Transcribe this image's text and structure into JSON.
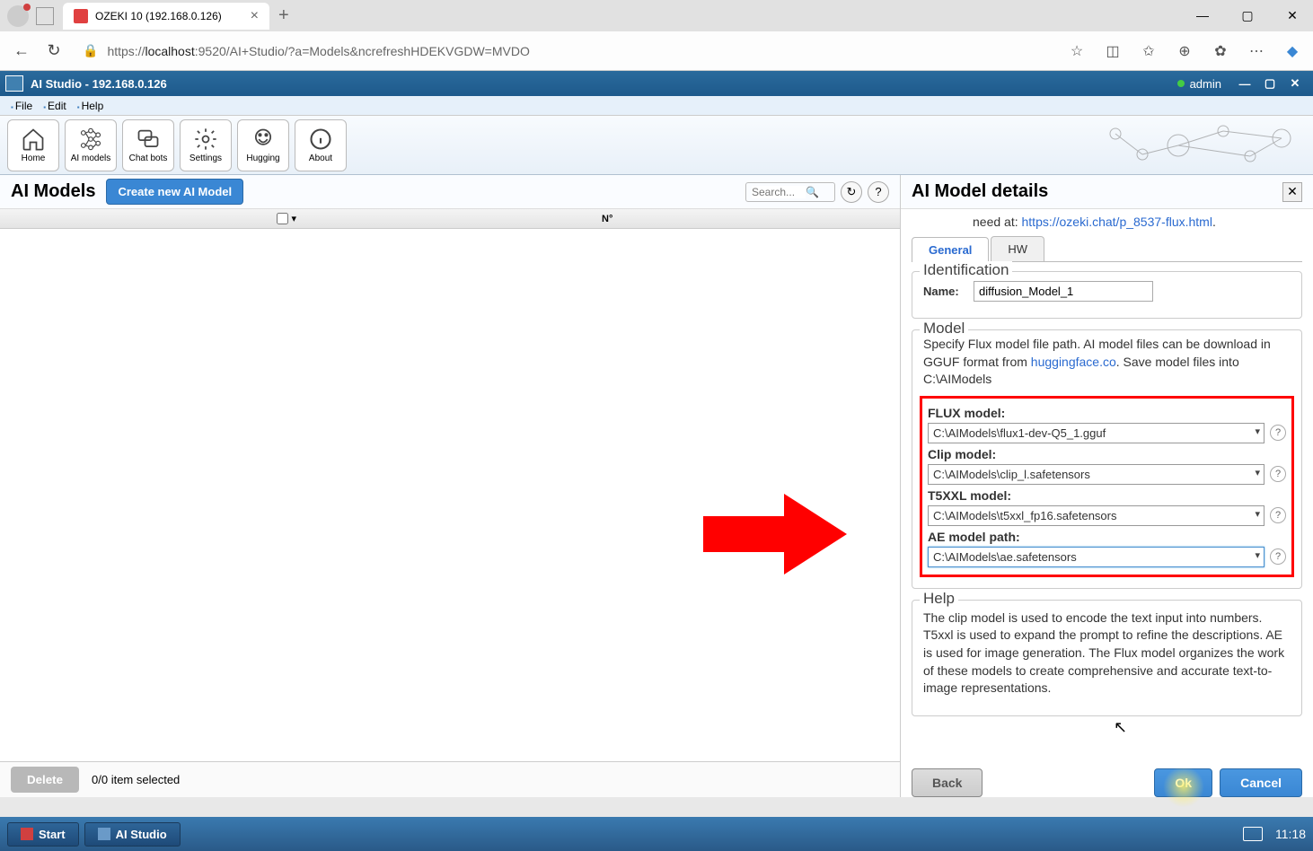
{
  "browser": {
    "tab_title": "OZEKI 10 (192.168.0.126)",
    "url_prefix": "https://",
    "url_host": "localhost",
    "url_rest": ":9520/AI+Studio/?a=Models&ncrefreshHDEKVGDW=MVDO"
  },
  "app": {
    "title": "AI Studio - 192.168.0.126",
    "user": "admin"
  },
  "menu": {
    "file": "File",
    "edit": "Edit",
    "help": "Help"
  },
  "toolbar": {
    "home": "Home",
    "models": "AI models",
    "chatbots": "Chat bots",
    "settings": "Settings",
    "hugging": "Hugging",
    "about": "About"
  },
  "left": {
    "title": "AI Models",
    "create_btn": "Create new AI Model",
    "search_placeholder": "Search...",
    "col_no": "N°",
    "delete": "Delete",
    "selection": "0/0 item selected"
  },
  "right": {
    "title": "AI Model details",
    "need_prefix": "need at: ",
    "need_link": "https://ozeki.chat/p_8537-flux.html",
    "tab_general": "General",
    "tab_hw": "HW",
    "ident_legend": "Identification",
    "name_label": "Name:",
    "name_value": "diffusion_Model_1",
    "model_legend": "Model",
    "model_desc1": "Specify Flux model file path. AI model files can be download in GGUF format from ",
    "model_link": "huggingface.co",
    "model_desc2": ". Save model files into C:\\AIModels",
    "flux_label": "FLUX model:",
    "flux_value": "C:\\AIModels\\flux1-dev-Q5_1.gguf",
    "clip_label": "Clip model:",
    "clip_value": "C:\\AIModels\\clip_l.safetensors",
    "t5_label": "T5XXL model:",
    "t5_value": "C:\\AIModels\\t5xxl_fp16.safetensors",
    "ae_label": "AE model path:",
    "ae_value": "C:\\AIModels\\ae.safetensors",
    "help_legend": "Help",
    "help_text": "The clip model is used to encode the text input into numbers. T5xxl is used to expand the prompt to refine the descriptions. AE is used for image generation. The Flux model organizes the work of these models to create comprehensive and accurate text-to-image representations.",
    "back": "Back",
    "ok": "Ok",
    "cancel": "Cancel"
  },
  "taskbar": {
    "start": "Start",
    "app": "AI Studio",
    "time": "11:18"
  }
}
